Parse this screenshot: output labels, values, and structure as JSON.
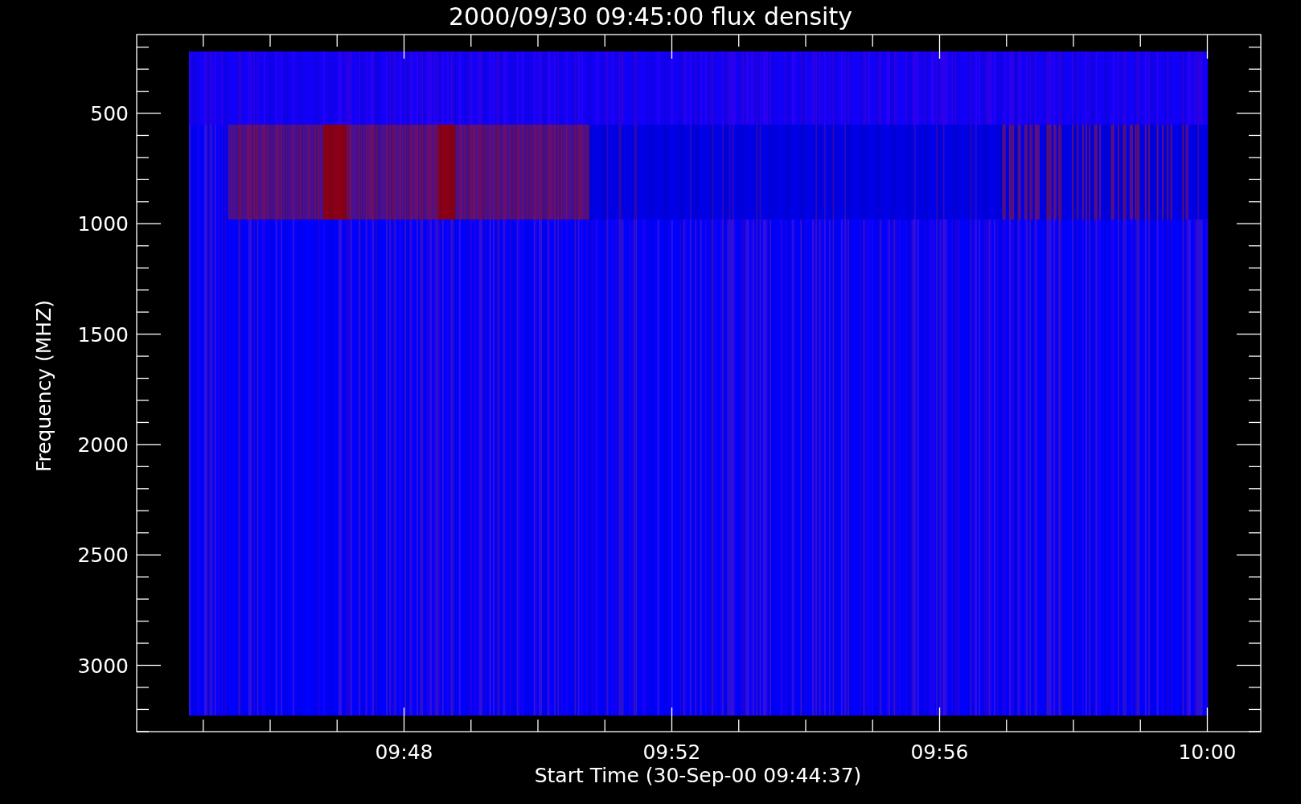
{
  "chart": {
    "title": "2000/09/30 09:45:00 flux density",
    "y_axis": {
      "label": "Frequency (MHZ)",
      "ticks": [
        "500",
        "1000",
        "1500",
        "2000",
        "2500",
        "3000"
      ]
    },
    "x_axis": {
      "label": "Start Time (30-Sep-00 09:44:37)",
      "ticks": [
        "09:48",
        "09:52",
        "09:56",
        "10:00"
      ]
    }
  }
}
